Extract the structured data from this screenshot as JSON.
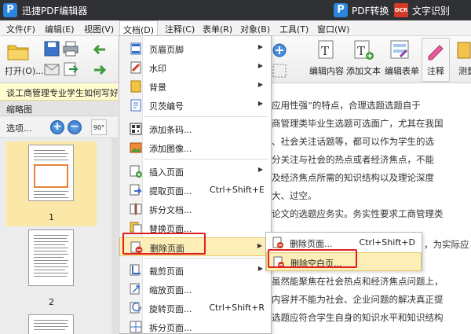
{
  "titlebar": {
    "app_logo_letter": "P",
    "app_title": "迅捷PDF编辑器",
    "pdf_convert_logo_letter": "P",
    "pdf_convert": "PDF转换",
    "ocr_badge": "OCR",
    "ocr_label": "文字识别"
  },
  "menubar": {
    "items": [
      "文件(F)",
      "编辑(E)",
      "视图(V)",
      "文档(D)",
      "注释(C)",
      "表单(R)",
      "对象(B)",
      "工具(T)",
      "窗口(W)"
    ]
  },
  "toolbar": {
    "open_label": "打开(O)...",
    "edit_content_label": "编辑内容",
    "add_text_label": "添加文本",
    "edit_form_label": "编辑表单",
    "annotate_label": "注释",
    "measure_label": "测量",
    "rotate_label": "90°"
  },
  "tab": {
    "title": "谈工商管理专业学生如何写好毕"
  },
  "thumbnails": {
    "title": "缩略图",
    "options": "选项...",
    "pages": [
      "1",
      "2"
    ]
  },
  "document": {
    "lines": [
      "应用性强”的特点，合理选题选题自于",
      "商管理类毕业生选题可选面广，尤其在我国",
      "、社会关注话题等，都可以作为学生的选",
      "分关注与社会的热点或者经济焦点，不能",
      "及经济焦点所需的知识结构以及理论深度",
      "大、过空。",
      "论文的选题应务实。务实性要求工商管理类",
      "，为实际应",
      "虽然能聚焦在社会热点和经济焦点问题上，",
      "内容并不能为社会、企业问题的解决真正提",
      "选题应符合学生自身的知识水平和知识结构"
    ]
  },
  "dropdown": {
    "items": [
      {
        "label": "页眉页脚",
        "arrow": "▶"
      },
      {
        "label": "水印",
        "arrow": "▶"
      },
      {
        "label": "背景",
        "arrow": "▶"
      },
      {
        "label": "贝茨编号",
        "arrow": "▶"
      },
      {
        "label": "添加条码..."
      },
      {
        "label": "添加图像..."
      },
      {
        "label": "插入页面",
        "arrow": "▶"
      },
      {
        "label": "提取页面...",
        "shortcut": "Ctrl+Shift+E"
      },
      {
        "label": "拆分文档..."
      },
      {
        "label": "替换页面..."
      },
      {
        "label": "删除页面",
        "arrow": "▶"
      },
      {
        "label": "裁剪页面",
        "arrow": "▶"
      },
      {
        "label": "缩放页面..."
      },
      {
        "label": "旋转页面...",
        "shortcut": "Ctrl+Shift+R"
      },
      {
        "label": "拆分页面..."
      }
    ]
  },
  "submenu": {
    "items": [
      {
        "label": "删除页面...",
        "shortcut": "Ctrl+Shift+D"
      },
      {
        "label": "删除空白页..."
      }
    ]
  },
  "colors": {
    "titlebar": "#2f3135",
    "highlight": "#fdeeb8",
    "annotation_red": "#e02020",
    "accent_blue": "#2b86e0"
  }
}
